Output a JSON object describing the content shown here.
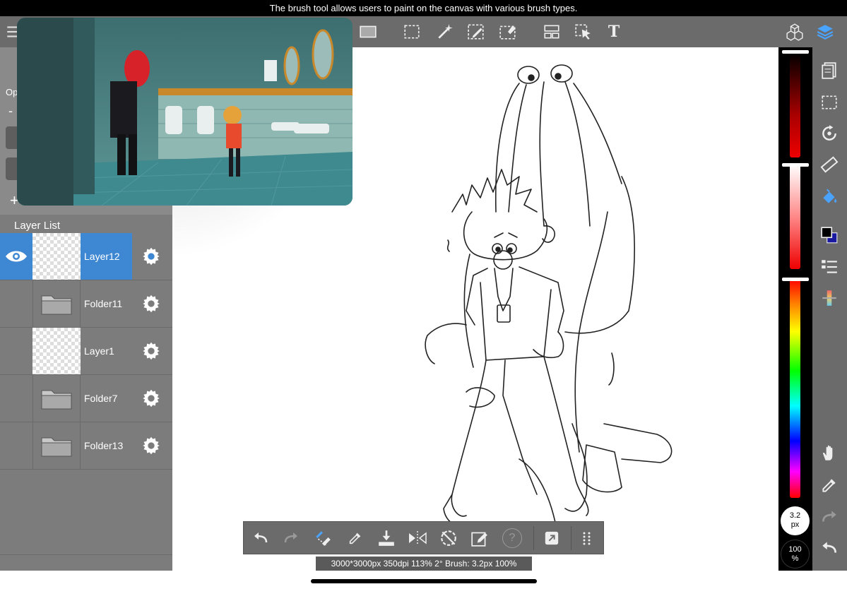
{
  "tip": {
    "text": "The brush tool allows users to paint on the canvas with various brush types."
  },
  "toolbar": {
    "left_icons": [
      "menu-icon"
    ],
    "icons": [
      "fill-rect-icon",
      "marquee-select-icon",
      "magic-wand-icon",
      "pen-select-icon",
      "eraser-select-icon",
      "transform-icon",
      "move-icon",
      "text-tool-icon",
      "materials-icon",
      "layers-icon"
    ],
    "text_tool_label": "T"
  },
  "left_panel": {
    "opacity_prefix": "Op",
    "minus": "-",
    "layer_list_title": "Layer List",
    "layers": [
      {
        "name": "Layer12",
        "type": "layer",
        "selected": true,
        "visible": true
      },
      {
        "name": "Folder11",
        "type": "folder",
        "selected": false
      },
      {
        "name": "Layer1",
        "type": "layer",
        "selected": false
      },
      {
        "name": "Folder7",
        "type": "folder",
        "selected": false
      },
      {
        "name": "Folder13",
        "type": "folder",
        "selected": false
      }
    ],
    "add_symbol": "+"
  },
  "color_panel": {
    "brush_size": "3.2",
    "brush_size_unit": "px",
    "opacity": "100",
    "opacity_unit": "%",
    "primary_color": "#000000",
    "secondary_color": "#1a1aa0"
  },
  "status_bar": {
    "text": "3000*3000px 350dpi 113% 2° Brush: 3.2px 100%"
  },
  "bottom_toolbar": {
    "icons": [
      "undo-icon",
      "redo-icon",
      "brush-eraser-icon",
      "eyedropper-icon",
      "import-icon",
      "flip-icon",
      "rotate-reset-icon",
      "edit-icon",
      "help-icon",
      "share-icon",
      "grid-icon"
    ],
    "help_label": "?"
  },
  "right_tools": [
    "pages-icon",
    "selection-icon",
    "rotate-icon",
    "ruler-icon",
    "fill-bucket-icon",
    "color-swap-icon",
    "list-icon",
    "gradient-icon",
    "hand-icon",
    "eyedropper-icon",
    "redo-icon",
    "undo-icon"
  ]
}
